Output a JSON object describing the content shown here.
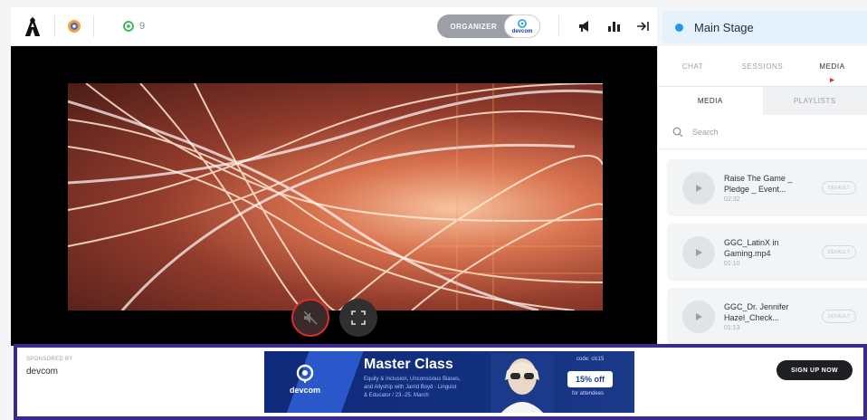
{
  "topbar": {
    "viewer_count": "9",
    "organizer_label": "ORGANIZER",
    "organizer_badge_text": "devcom",
    "icons": [
      "app-logo-icon",
      "camera-icon",
      "eye-icon",
      "megaphone-icon",
      "poll-icon",
      "collapse-panel-icon"
    ]
  },
  "stage": {
    "label": "Main Stage",
    "dot_color": "#2196f3"
  },
  "video": {
    "controls": [
      "mute-icon",
      "fullscreen-icon"
    ]
  },
  "panel": {
    "tabs": [
      {
        "label": "CHAT"
      },
      {
        "label": "SESSIONS"
      },
      {
        "label": "MEDIA"
      }
    ],
    "subtabs": [
      {
        "label": "MEDIA"
      },
      {
        "label": "PLAYLISTS"
      }
    ],
    "search_placeholder": "Search",
    "items": [
      {
        "title_line1": "Raise The Game _",
        "title_line2": "Pledge _ Event...",
        "duration": "02:32",
        "badge": "DEFAULT"
      },
      {
        "title_line1": "GGC_LatinX in",
        "title_line2": "Gaming.mp4",
        "duration": "01:10",
        "badge": "DEFAULT"
      },
      {
        "title_line1": "GGC_Dr. Jennifer",
        "title_line2": "Hazel_Check...",
        "duration": "01:13",
        "badge": "DEFAULT"
      }
    ]
  },
  "sponsor": {
    "sponsored_by": "SPONSORED BY",
    "name": "devcom",
    "ad": {
      "brand": "devcom",
      "headline": "Master Class",
      "desc_line1": "Equity & Inclusion, Unconscious Biases,",
      "desc_line2": "and Allyship with Jarrid Boyd - Linguist",
      "desc_line3": "& Educator / 23.-25. March",
      "code": "code: clc15",
      "offer": "15% off",
      "offer_note": "for attendees"
    },
    "cta": "SIGN UP NOW",
    "border_color": "#3a2a8f"
  }
}
